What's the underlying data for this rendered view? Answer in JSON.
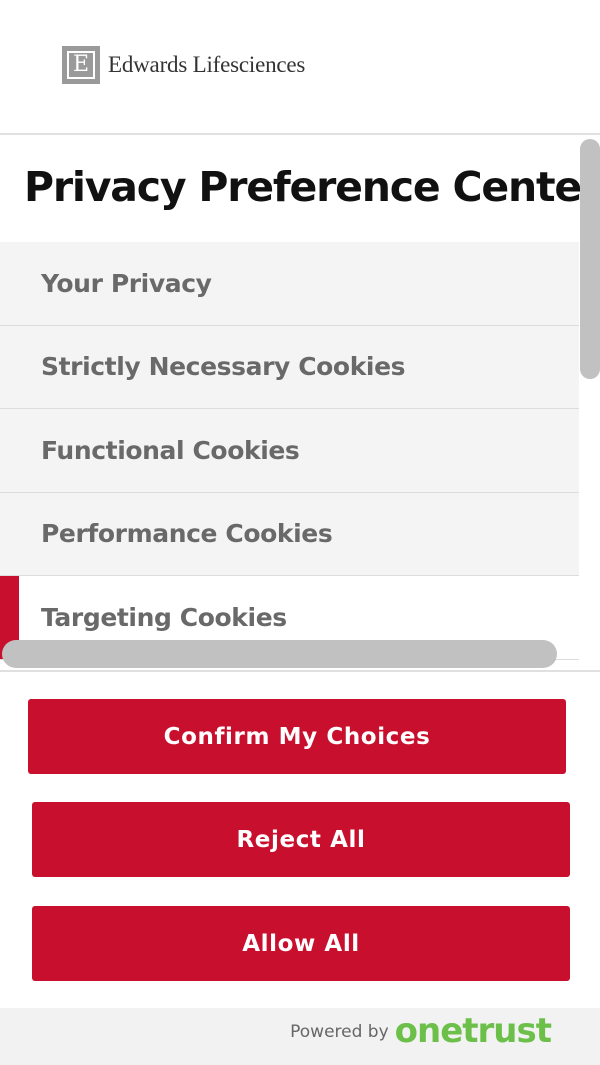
{
  "header": {
    "logo_mark": "E",
    "logo_text": "Edwards Lifesciences"
  },
  "page": {
    "title": "Privacy Preference Cente"
  },
  "menu": {
    "items": [
      {
        "label": "Your Privacy"
      },
      {
        "label": "Strictly Necessary Cookies"
      },
      {
        "label": "Functional Cookies"
      },
      {
        "label": "Performance Cookies"
      },
      {
        "label": "Targeting Cookies",
        "active": true
      }
    ]
  },
  "buttons": {
    "confirm_label": "Confirm My Choices",
    "reject_label": "Reject All",
    "allow_label": "Allow All"
  },
  "footer": {
    "powered_label": "Powered by",
    "brand": "onetrust"
  },
  "colors": {
    "accent": "#c8102e",
    "brand_green": "#6cc04a",
    "menu_bg": "#f4f4f4",
    "menu_text": "#696969"
  }
}
